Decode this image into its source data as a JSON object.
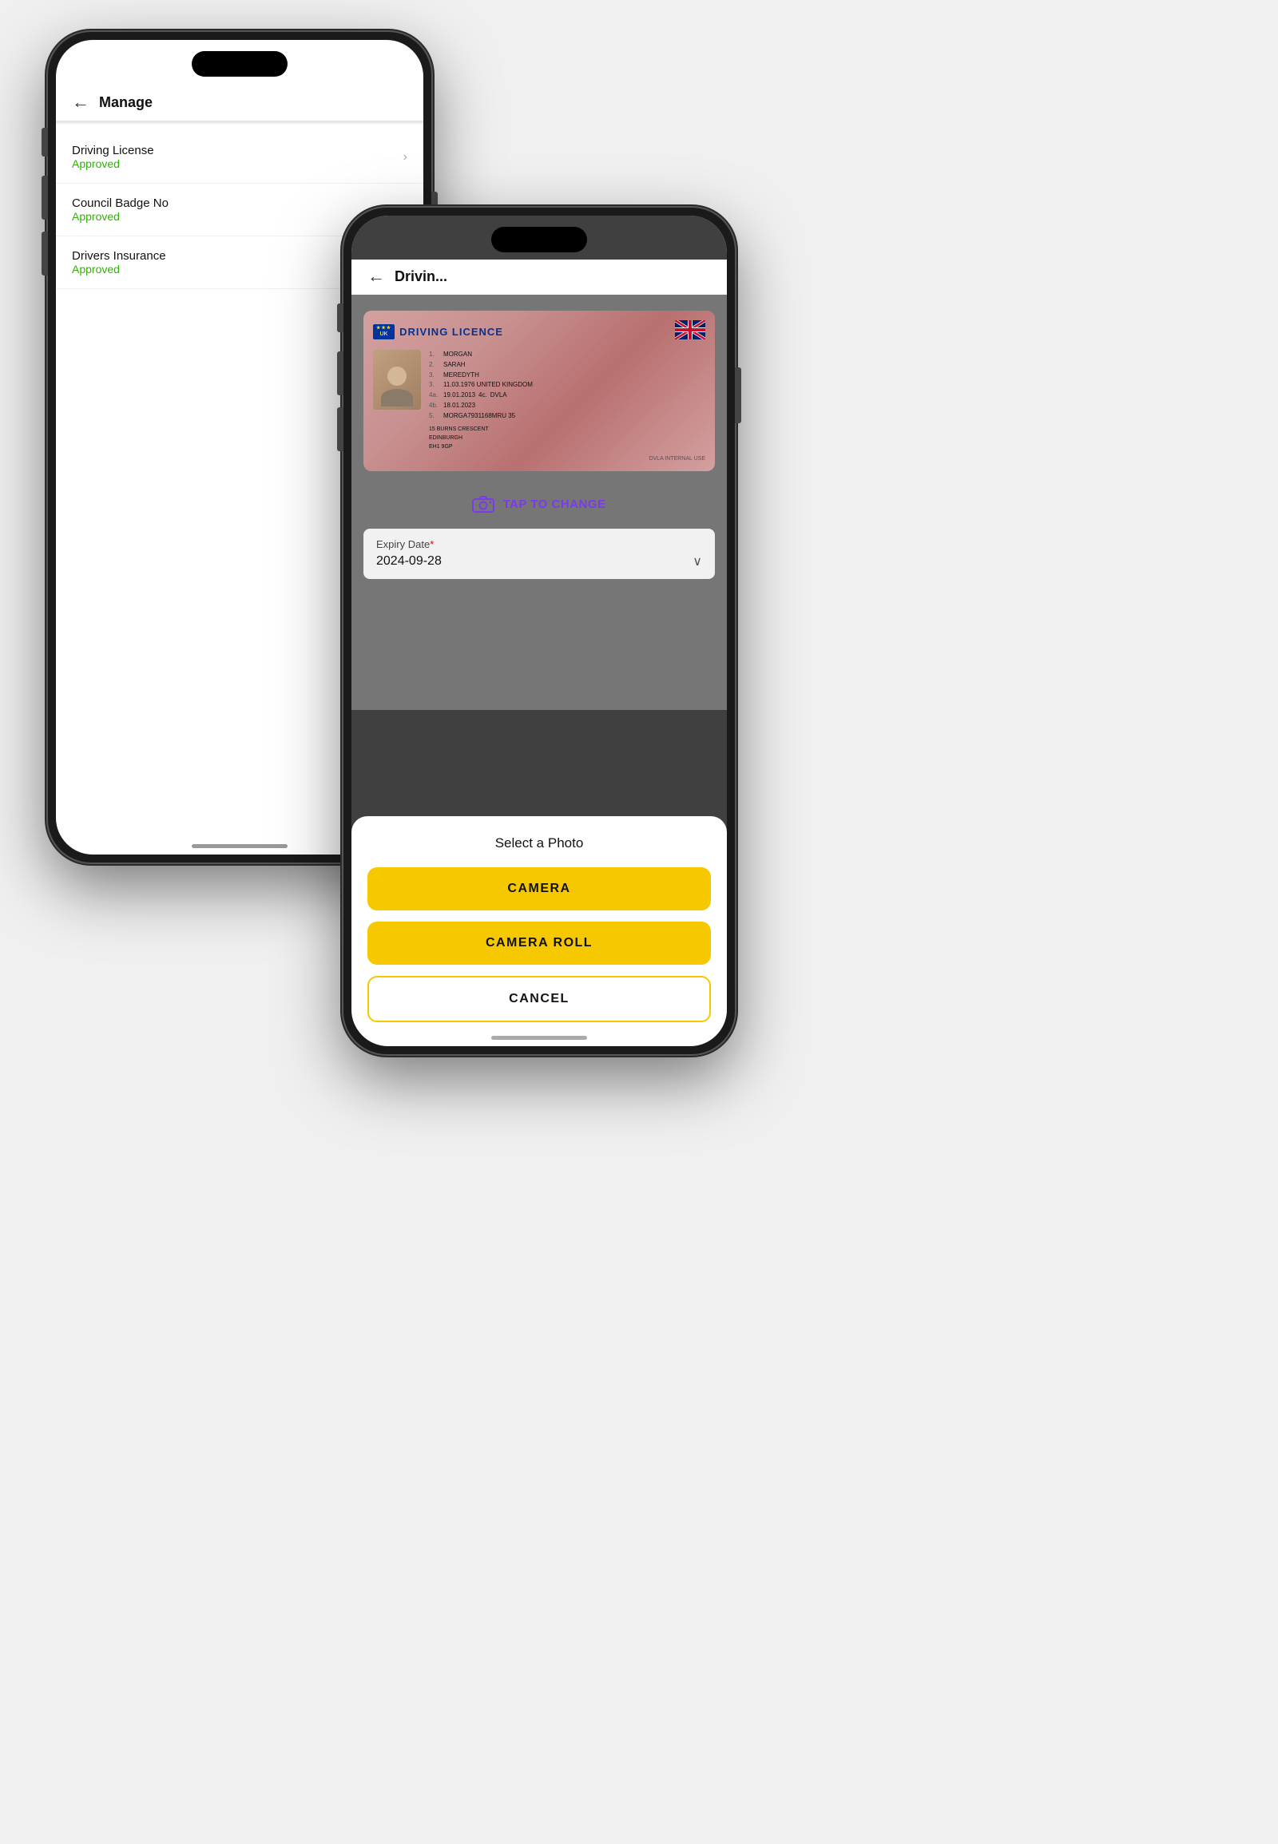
{
  "back_phone": {
    "header": {
      "back_arrow": "←",
      "title": "Manage"
    },
    "items": [
      {
        "label": "Driving License",
        "status": "Approved",
        "has_chevron": true
      },
      {
        "label": "Council Badge No",
        "status": "Approved",
        "has_chevron": false
      },
      {
        "label": "Drivers Insurance",
        "status": "Approved",
        "has_chevron": false
      }
    ]
  },
  "front_phone": {
    "header": {
      "back_arrow": "←",
      "title": "Drivin..."
    },
    "license_card": {
      "title": "DRIVING LICENCE",
      "uk_label": "UK",
      "name_1": "MORGAN",
      "name_2": "SARAH",
      "name_3": "MEREDYTH",
      "detail_3": "11.03.1976 UNITED KINGDOM",
      "detail_4a": "19.01.2013",
      "detail_4b": "DVLA",
      "detail_4c": "18.01.2023",
      "detail_5": "MORGA7931168MRU 35",
      "address": "15 BURNS CRESCENT\nEDINBURGH\nEH1 9GP",
      "footer": "DVLA INTERNAL USE"
    },
    "tap_to_change": "TAP TO CHANGE",
    "expiry": {
      "label": "Expiry Date",
      "required_marker": "*",
      "value": "2024-09-28"
    },
    "bottom_sheet": {
      "title": "Select a Photo",
      "camera_btn": "CAMERA",
      "camera_roll_btn": "CAMERA ROLL",
      "cancel_btn": "CANCEL"
    }
  }
}
